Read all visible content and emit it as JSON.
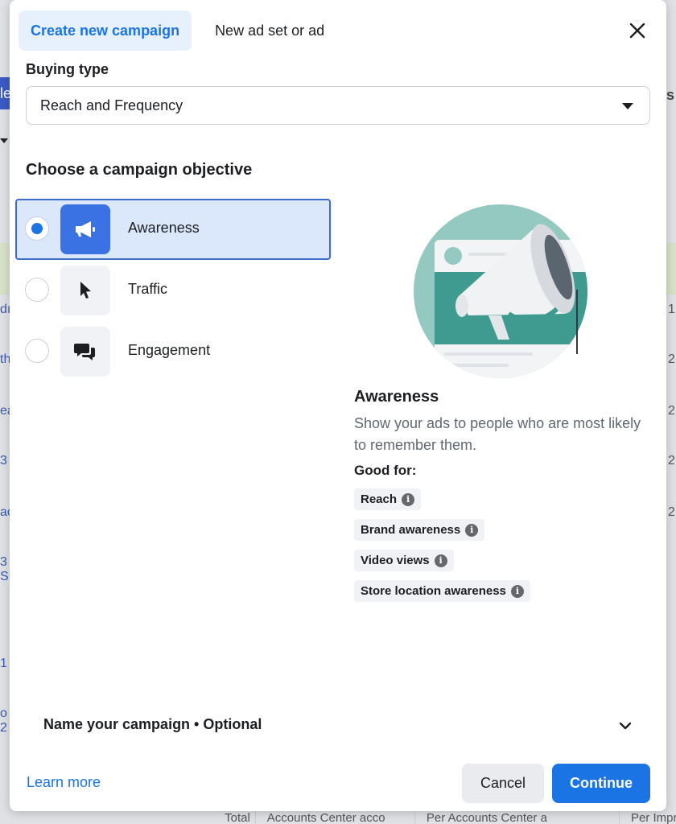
{
  "tabs": [
    {
      "label": "Create new campaign",
      "active": true
    },
    {
      "label": "New ad set or ad",
      "active": false
    }
  ],
  "buying_type": {
    "label": "Buying type",
    "value": "Reach and Frequency"
  },
  "objective": {
    "title": "Choose a campaign objective",
    "options": [
      {
        "label": "Awareness",
        "icon": "megaphone-icon",
        "selected": true
      },
      {
        "label": "Traffic",
        "icon": "cursor-icon",
        "selected": false
      },
      {
        "label": "Engagement",
        "icon": "chat-bubbles-icon",
        "selected": false
      }
    ]
  },
  "detail": {
    "title": "Awareness",
    "description": "Show your ads to people who are most likely to remember them.",
    "good_for_label": "Good for:",
    "tags": [
      "Reach",
      "Brand awareness",
      "Video views",
      "Store location awareness"
    ]
  },
  "name_campaign": {
    "label": "Name your campaign • Optional"
  },
  "footer": {
    "learn_more": "Learn more",
    "cancel": "Cancel",
    "continue": "Continue"
  },
  "colors": {
    "accent": "#1b74e4",
    "selected_bg": "#dbe7fb",
    "icon_selected_bg": "#3b72e3"
  }
}
